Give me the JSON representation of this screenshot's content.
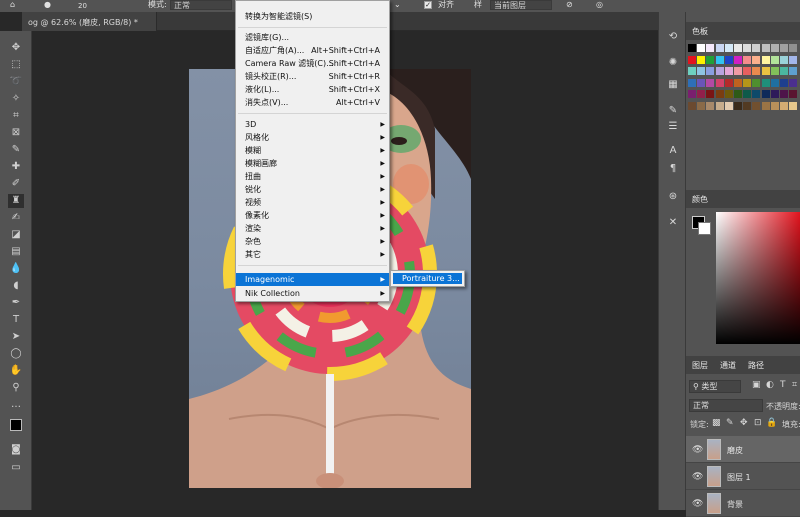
{
  "options_bar": {
    "brush_size": "20",
    "mode_label": "模式:",
    "mode_value": "正常",
    "sample_label": "对齐",
    "sample_value": "当前图层"
  },
  "document": {
    "tab_title": "og @ 62.6% (磨皮, RGB/8) *"
  },
  "filter_menu": {
    "items": [
      {
        "label": "转换为智能滤镜(S)",
        "shortcut": "",
        "submenu": false
      },
      {
        "label": "滤镜库(G)...",
        "shortcut": "",
        "submenu": false
      },
      {
        "label": "自适应广角(A)...",
        "shortcut": "Alt+Shift+Ctrl+A",
        "submenu": false
      },
      {
        "label": "Camera Raw 滤镜(C)...",
        "shortcut": "Shift+Ctrl+A",
        "submenu": false
      },
      {
        "label": "镜头校正(R)...",
        "shortcut": "Shift+Ctrl+R",
        "submenu": false
      },
      {
        "label": "液化(L)...",
        "shortcut": "Shift+Ctrl+X",
        "submenu": false
      },
      {
        "label": "消失点(V)...",
        "shortcut": "Alt+Ctrl+V",
        "submenu": false
      },
      {
        "label": "3D",
        "shortcut": "",
        "submenu": true
      },
      {
        "label": "风格化",
        "shortcut": "",
        "submenu": true
      },
      {
        "label": "模糊",
        "shortcut": "",
        "submenu": true
      },
      {
        "label": "模糊画廊",
        "shortcut": "",
        "submenu": true
      },
      {
        "label": "扭曲",
        "shortcut": "",
        "submenu": true
      },
      {
        "label": "锐化",
        "shortcut": "",
        "submenu": true
      },
      {
        "label": "视频",
        "shortcut": "",
        "submenu": true
      },
      {
        "label": "像素化",
        "shortcut": "",
        "submenu": true
      },
      {
        "label": "渲染",
        "shortcut": "",
        "submenu": true
      },
      {
        "label": "杂色",
        "shortcut": "",
        "submenu": true
      },
      {
        "label": "其它",
        "shortcut": "",
        "submenu": true
      },
      {
        "label": "Imagenomic",
        "shortcut": "",
        "submenu": true
      },
      {
        "label": "Nik Collection",
        "shortcut": "",
        "submenu": true
      }
    ],
    "submenu_item": "Portraiture 3..."
  },
  "panels": {
    "swatches_title": "色板",
    "color_title": "颜色",
    "layers_tab": "图层",
    "channels_tab": "通道",
    "paths_tab": "路径",
    "filter_kind": "类型",
    "blend_mode": "正常",
    "opacity_label": "不透明度:",
    "lock_label": "锁定:",
    "fill_label": "填充:",
    "layers": [
      {
        "name": "磨皮",
        "selected": true
      },
      {
        "name": "图层 1",
        "selected": false
      },
      {
        "name": "背景",
        "selected": false
      }
    ]
  },
  "colors": {
    "menu_highlight": "#0b74d6",
    "panel_bg": "#535353",
    "canvas_bg": "#282828"
  }
}
